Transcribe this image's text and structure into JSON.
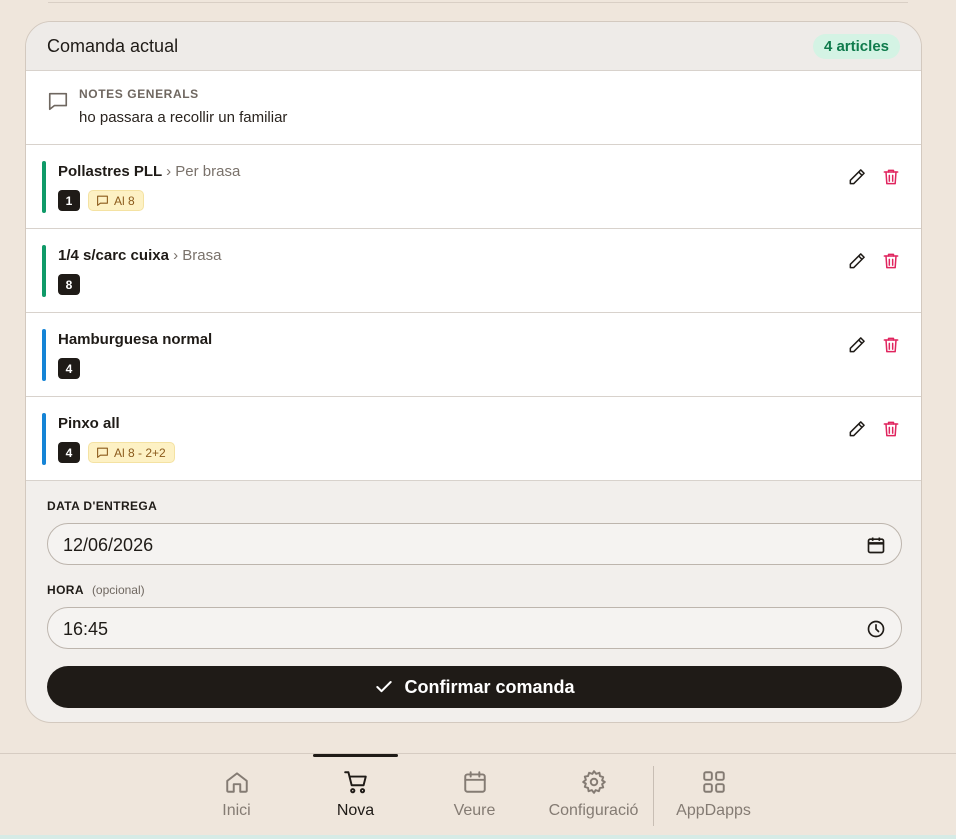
{
  "order": {
    "title": "Comanda actual",
    "count_badge": "4 articles",
    "notes_label": "NOTES GENERALS",
    "notes_text": "ho passara a recollir un familiar",
    "items": [
      {
        "name": "Pollastres PLL",
        "sub": "› Per brasa",
        "qty": "1",
        "note": "Al 8",
        "bar_color": "#0f9a68"
      },
      {
        "name": "1/4 s/carc cuixa",
        "sub": "› Brasa",
        "qty": "8",
        "note": "",
        "bar_color": "#0f9a68"
      },
      {
        "name": "Hamburguesa normal",
        "sub": "",
        "qty": "4",
        "note": "",
        "bar_color": "#1584d6"
      },
      {
        "name": "Pinxo all",
        "sub": "",
        "qty": "4",
        "note": "Al 8 - 2+2",
        "bar_color": "#1584d6"
      }
    ]
  },
  "form": {
    "date_label": "DATA D'ENTREGA",
    "date_value": "12/06/2026",
    "time_label": "HORA",
    "time_optional": "(opcional)",
    "time_value": "16:45",
    "confirm_label": "Confirmar comanda"
  },
  "nav": {
    "items": [
      {
        "label": "Inici",
        "icon": "home-icon"
      },
      {
        "label": "Nova",
        "icon": "cart-icon"
      },
      {
        "label": "Veure",
        "icon": "calendar-icon"
      },
      {
        "label": "Configuració",
        "icon": "gear-icon"
      },
      {
        "label": "AppDapps",
        "icon": "apps-grid-icon"
      }
    ],
    "active": "Nova"
  },
  "colors": {
    "accent": "#1f1b17",
    "success_badge": "#0f7b4c",
    "delete": "#e0245e",
    "note_chip": "#fdf1c4"
  }
}
